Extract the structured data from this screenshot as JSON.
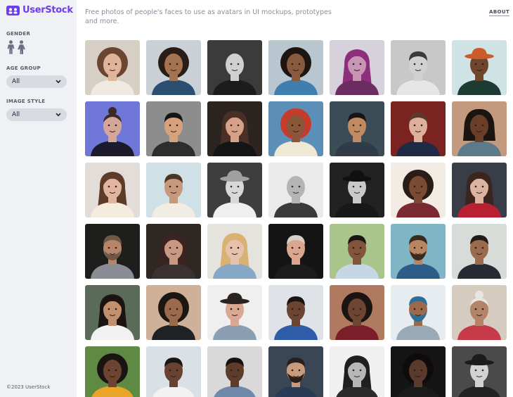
{
  "brand": {
    "name": "UserStock",
    "accent": "#6f3cf0"
  },
  "filters": {
    "gender_label": "GENDER",
    "age_label": "AGE GROUP",
    "age_value": "All",
    "style_label": "IMAGE STYLE",
    "style_value": "All"
  },
  "header": {
    "tagline": "Free photos of people's faces to use as avatars in UI mockups, prototypes and more.",
    "about": "ABOUT"
  },
  "footer": "©2023 UserStock",
  "photos": [
    {
      "bg": "#d8cfc4",
      "skin": "#e0b49a",
      "hair": "#6a4632",
      "shirt": "#efe9e1",
      "hs": "curly",
      "gray": false
    },
    {
      "bg": "#c9d1d6",
      "skin": "#a5734f",
      "hair": "#2a1d16",
      "shirt": "#2b4f73",
      "hs": "curly",
      "gray": false
    },
    {
      "bg": "#3b3b3b",
      "skin": "#d0d0d0",
      "hair": "#c4c4c4",
      "shirt": "#1c1c1c",
      "hs": "bald",
      "gray": true
    },
    {
      "bg": "#b7c6cf",
      "skin": "#8a5a3e",
      "hair": "#1e1512",
      "shirt": "#3f7fb0",
      "hs": "curly",
      "gray": false
    },
    {
      "bg": "#d7d1dc",
      "skin": "#c995b4",
      "hair": "#8d2f7c",
      "shirt": "#6c2c62",
      "hs": "long",
      "gray": false
    },
    {
      "bg": "#c8c8c8",
      "skin": "#d1d1d1",
      "hair": "#3a3a3a",
      "shirt": "#e6e6e6",
      "hs": "short",
      "gray": true
    },
    {
      "bg": "#cfe3e4",
      "skin": "#70452c",
      "hair": "#cc5b2c",
      "shirt": "#1e3b33",
      "hs": "hat",
      "gray": false
    },
    {
      "bg": "#6f78d8",
      "skin": "#d4a69a",
      "hair": "#3a2a28",
      "shirt": "#1b1b2c",
      "hs": "bun",
      "gray": false
    },
    {
      "bg": "#8d8d8d",
      "skin": "#d6a27d",
      "hair": "#151515",
      "shirt": "#2d2d2d",
      "hs": "short",
      "gray": false
    },
    {
      "bg": "#2b2420",
      "skin": "#d7a089",
      "hair": "#4a2f25",
      "shirt": "#151515",
      "hs": "long",
      "gray": false
    },
    {
      "bg": "#5b8fb8",
      "skin": "#8b563a",
      "hair": "#c63b2c",
      "shirt": "#efe8d4",
      "hs": "curly",
      "gray": false
    },
    {
      "bg": "#3b4c57",
      "skin": "#c08a63",
      "hair": "#1c1414",
      "shirt": "#2f3b47",
      "hs": "short",
      "gray": false
    },
    {
      "bg": "#7a2321",
      "skin": "#dcb09b",
      "hair": "#5a3a2a",
      "shirt": "#1f2a47",
      "hs": "short",
      "gray": false
    },
    {
      "bg": "#c49a7e",
      "skin": "#6b3e2a",
      "hair": "#1b1512",
      "shirt": "#5b7b8a",
      "hs": "dread",
      "gray": false
    },
    {
      "bg": "#e2ddd8",
      "skin": "#e1b59f",
      "hair": "#5e3a28",
      "shirt": "#f4ecdf",
      "hs": "long",
      "gray": false
    },
    {
      "bg": "#cfe0e6",
      "skin": "#c7987c",
      "hair": "#4b3424",
      "shirt": "#f1ece4",
      "hs": "short",
      "gray": false
    },
    {
      "bg": "#3e3e3e",
      "skin": "#d8d8d8",
      "hair": "#a0a0a0",
      "shirt": "#efefef",
      "hs": "hat",
      "gray": true
    },
    {
      "bg": "#eaeaea",
      "skin": "#b4b4b4",
      "hair": "#d8d8d8",
      "shirt": "#3a3a3a",
      "hs": "bald",
      "gray": true
    },
    {
      "bg": "#222222",
      "skin": "#c9c9c9",
      "hair": "#101010",
      "shirt": "#181818",
      "hs": "hat",
      "gray": true
    },
    {
      "bg": "#f2ece4",
      "skin": "#7a4a34",
      "hair": "#2a1c16",
      "shirt": "#7b2a31",
      "hs": "curly",
      "gray": false
    },
    {
      "bg": "#393d48",
      "skin": "#dcb2a0",
      "hair": "#3a251f",
      "shirt": "#b92133",
      "hs": "long",
      "gray": false
    },
    {
      "bg": "#1e1e1c",
      "skin": "#b7866a",
      "hair": "#6f5946",
      "shirt": "#8a8d95",
      "hs": "beard",
      "gray": false
    },
    {
      "bg": "#2e2722",
      "skin": "#c99884",
      "hair": "#3a2420",
      "shirt": "#3a3230",
      "hs": "long",
      "gray": false
    },
    {
      "bg": "#e4e3dd",
      "skin": "#e6c2ac",
      "hair": "#d9b172",
      "shirt": "#87a7c6",
      "hs": "long",
      "gray": false
    },
    {
      "bg": "#141414",
      "skin": "#dba690",
      "hair": "#d6d0c8",
      "shirt": "#1c1c1c",
      "hs": "short",
      "gray": false
    },
    {
      "bg": "#a9c58c",
      "skin": "#81553b",
      "hair": "#1a1512",
      "shirt": "#c7d6e5",
      "hs": "short",
      "gray": false
    },
    {
      "bg": "#7fb6c5",
      "skin": "#b98663",
      "hair": "#3a2a1f",
      "shirt": "#2d5d86",
      "hs": "beard",
      "gray": false
    },
    {
      "bg": "#d8dcd9",
      "skin": "#9b6b4e",
      "hair": "#221a15",
      "shirt": "#272c34",
      "hs": "short",
      "gray": false
    },
    {
      "bg": "#5a6b5a",
      "skin": "#c1906f",
      "hair": "#1b1412",
      "shirt": "#f1f1f1",
      "hs": "long",
      "gray": false
    },
    {
      "bg": "#cfb199",
      "skin": "#9a6a4a",
      "hair": "#1c1612",
      "shirt": "#1f2124",
      "hs": "curly",
      "gray": false
    },
    {
      "bg": "#efefef",
      "skin": "#d8a893",
      "hair": "#2a2322",
      "shirt": "#8aa0b2",
      "hs": "hat",
      "gray": false
    },
    {
      "bg": "#dfe2e6",
      "skin": "#6b4532",
      "hair": "#1a1512",
      "shirt": "#2f5ca6",
      "hs": "short",
      "gray": false
    },
    {
      "bg": "#b07a60",
      "skin": "#6e4433",
      "hair": "#1c1412",
      "shirt": "#7a1f2a",
      "hs": "curly",
      "gray": false
    },
    {
      "bg": "#e6ecef",
      "skin": "#9b6a4c",
      "hair": "#2b6f9a",
      "shirt": "#9aa9b6",
      "hs": "beard",
      "gray": false
    },
    {
      "bg": "#d6cbbf",
      "skin": "#b4846a",
      "hair": "#e9e6e2",
      "shirt": "#c73a4a",
      "hs": "bun",
      "gray": false
    },
    {
      "bg": "#5f8a43",
      "skin": "#6d4432",
      "hair": "#1a1512",
      "shirt": "#e8a52a",
      "hs": "curly",
      "gray": false
    },
    {
      "bg": "#d9e1e6",
      "skin": "#6a4231",
      "hair": "#1a1512",
      "shirt": "#f2f2f2",
      "hs": "short",
      "gray": false
    },
    {
      "bg": "#d9d9d9",
      "skin": "#5d3c2c",
      "hair": "#171210",
      "shirt": "#6f8aa8",
      "hs": "short",
      "gray": false
    },
    {
      "bg": "#3a4653",
      "skin": "#c89b7e",
      "hair": "#2a1f1b",
      "shirt": "#2a3c55",
      "hs": "beard",
      "gray": false
    },
    {
      "bg": "#f0f0f0",
      "skin": "#b7b7b7",
      "hair": "#1f1f1f",
      "shirt": "#2a2a2a",
      "hs": "long",
      "gray": true
    },
    {
      "bg": "#141414",
      "skin": "#5a3a2c",
      "hair": "#0e0b0a",
      "shirt": "#1a1a1a",
      "hs": "curly",
      "gray": false
    },
    {
      "bg": "#4a4a4a",
      "skin": "#d2d2d2",
      "hair": "#1b1b1b",
      "shirt": "#222222",
      "hs": "hat",
      "gray": true
    }
  ]
}
